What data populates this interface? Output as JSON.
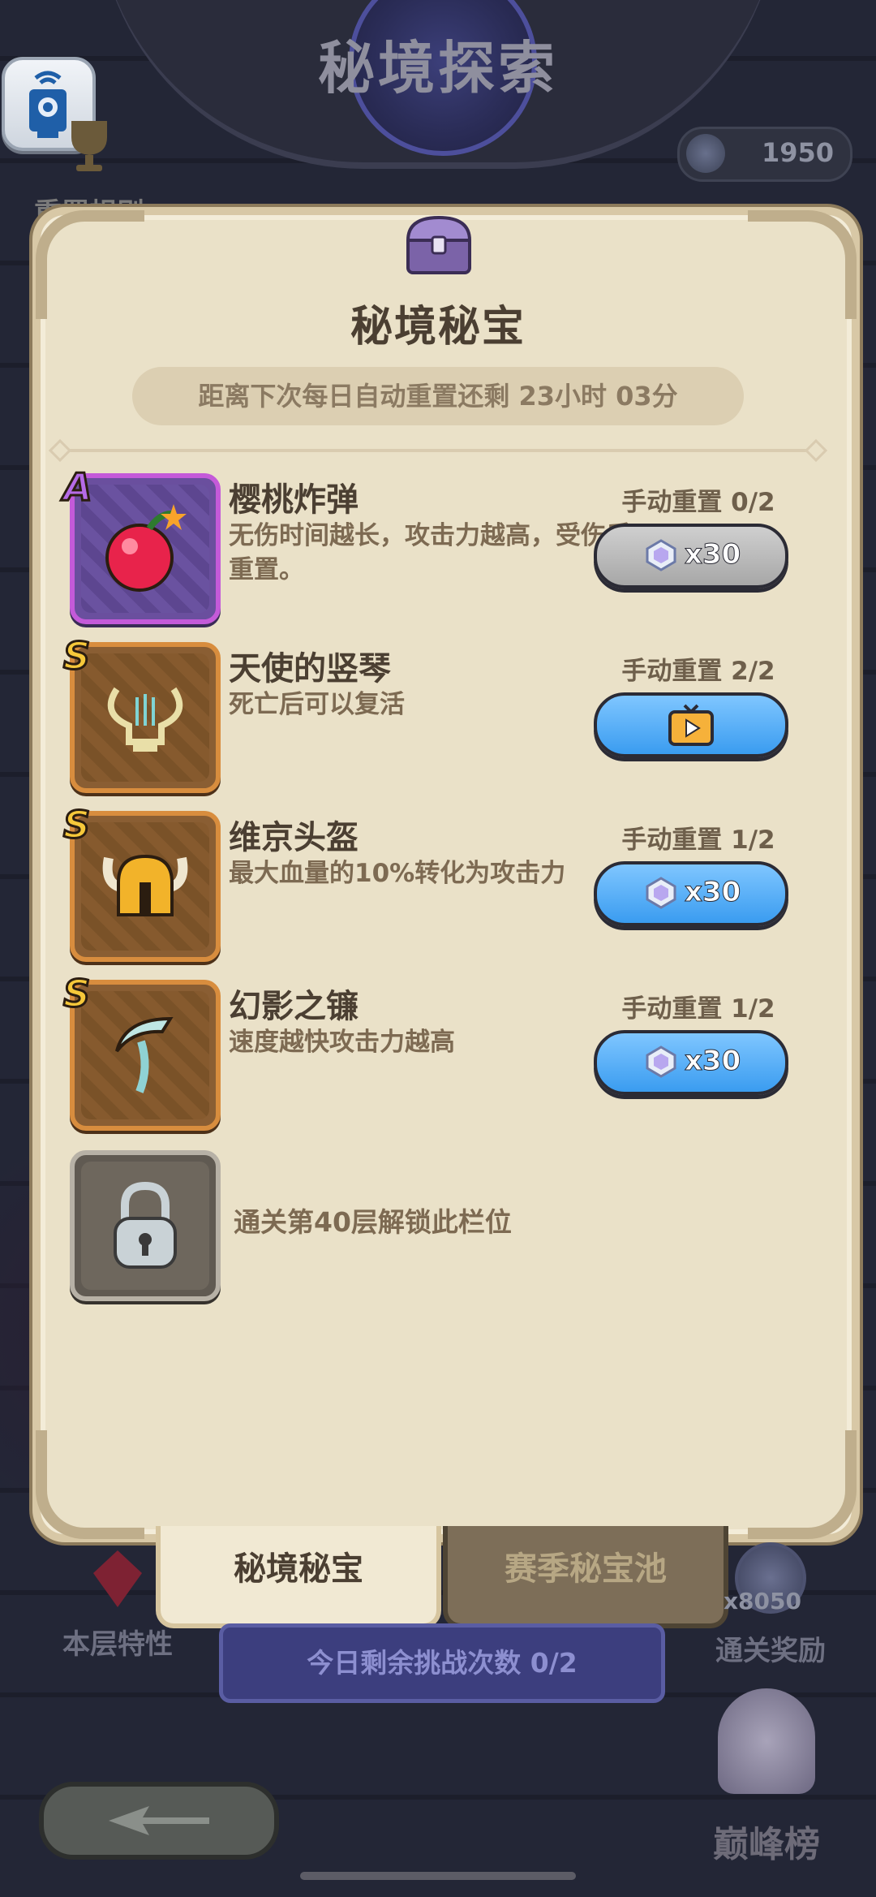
{
  "header": {
    "title": "秘境探索"
  },
  "top_left": {
    "rules_label": "重置规则"
  },
  "currency": {
    "value": "1950"
  },
  "panel": {
    "title": "秘境秘宝",
    "timer_text": "距离下次每日自动重置还剩 23小时 03分",
    "items": [
      {
        "grade": "A",
        "name": "樱桃炸弹",
        "desc": "无伤时间越长，攻击力越高，受伤后重置。",
        "reset": "手动重置 0/2",
        "cost": "x30"
      },
      {
        "grade": "S",
        "name": "天使的竖琴",
        "desc": "死亡后可以复活",
        "reset": "手动重置 2/2"
      },
      {
        "grade": "S",
        "name": "维京头盔",
        "desc": "最大血量的10%转化为攻击力",
        "reset": "手动重置 1/2",
        "cost": "x30"
      },
      {
        "grade": "S",
        "name": "幻影之镰",
        "desc": "速度越快攻击力越高",
        "reset": "手动重置 1/2",
        "cost": "x30"
      }
    ],
    "locked_text": "通关第40层解锁此栏位"
  },
  "tabs": {
    "active": "秘境秘宝",
    "inactive": "赛季秘宝池"
  },
  "bottom": {
    "floor_feature": "本层特性",
    "clear_reward": "通关奖励",
    "reward_count": "x8050",
    "challenge": "今日剩余挑战次数 0/2",
    "peak": "巅峰榜"
  },
  "colors": {
    "panel_bg": "#eae1c8",
    "accent_blue": "#3a9cf0",
    "disabled_gray": "#a7a7a7",
    "grade_a": "#c45ad9",
    "grade_s": "#d88d3e"
  }
}
